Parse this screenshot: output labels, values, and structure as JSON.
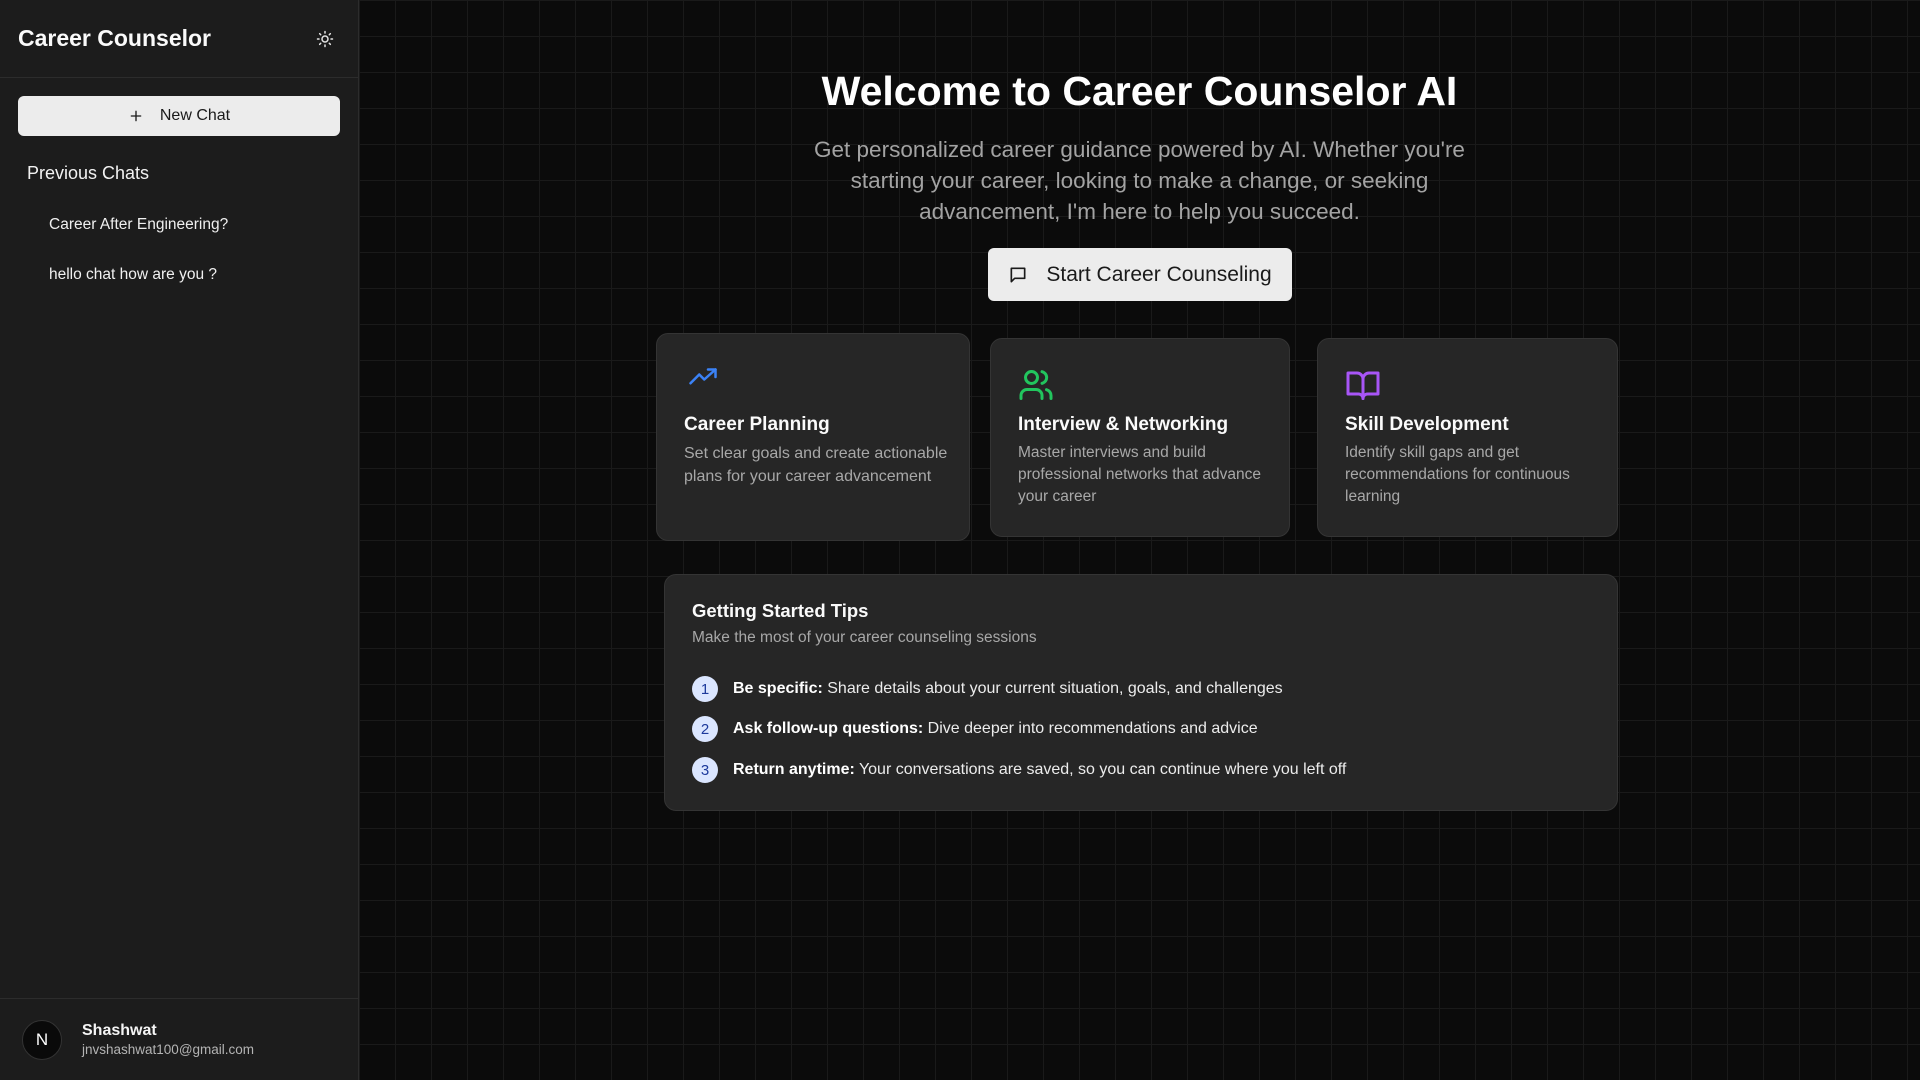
{
  "sidebar": {
    "title": "Career Counselor",
    "new_chat_label": "New Chat",
    "previous_label": "Previous Chats",
    "chats": [
      {
        "title": "Career After Engineering?"
      },
      {
        "title": "hello chat how are you ?"
      }
    ],
    "user": {
      "initial": "N",
      "name": "Shashwat",
      "email": "jnvshashwat100@gmail.com"
    }
  },
  "main": {
    "title": "Welcome to Career Counselor AI",
    "subtitle": "Get personalized career guidance powered by AI. Whether you're starting your career, looking to make a change, or seeking advancement, I'm here to help you succeed.",
    "cta_label": "Start Career Counseling",
    "cards": [
      {
        "title": "Career Planning",
        "description": "Set clear goals and create actionable plans for your career advancement",
        "icon": "trending-up-icon",
        "icon_color": "#3b82f6"
      },
      {
        "title": "Interview & Networking",
        "description": "Master interviews and build professional networks that advance your career",
        "icon": "users-icon",
        "icon_color": "#22c55e"
      },
      {
        "title": "Skill Development",
        "description": "Identify skill gaps and get recommendations for continuous learning",
        "icon": "book-open-icon",
        "icon_color": "#a855f7"
      }
    ],
    "tips": {
      "title": "Getting Started Tips",
      "subtitle": "Make the most of your career counseling sessions",
      "items": [
        {
          "num": "1",
          "bold": "Be specific:",
          "text": " Share details about your current situation, goals, and challenges"
        },
        {
          "num": "2",
          "bold": "Ask follow-up questions:",
          "text": " Dive deeper into recommendations and advice"
        },
        {
          "num": "3",
          "bold": "Return anytime:",
          "text": " Your conversations are saved, so you can continue where you left off"
        }
      ]
    }
  },
  "colors": {
    "background": "#0b0b0b",
    "sidebar": "#1c1c1c",
    "card": "#262626",
    "accent_blue": "#3b82f6",
    "accent_green": "#22c55e",
    "accent_purple": "#a855f7"
  }
}
